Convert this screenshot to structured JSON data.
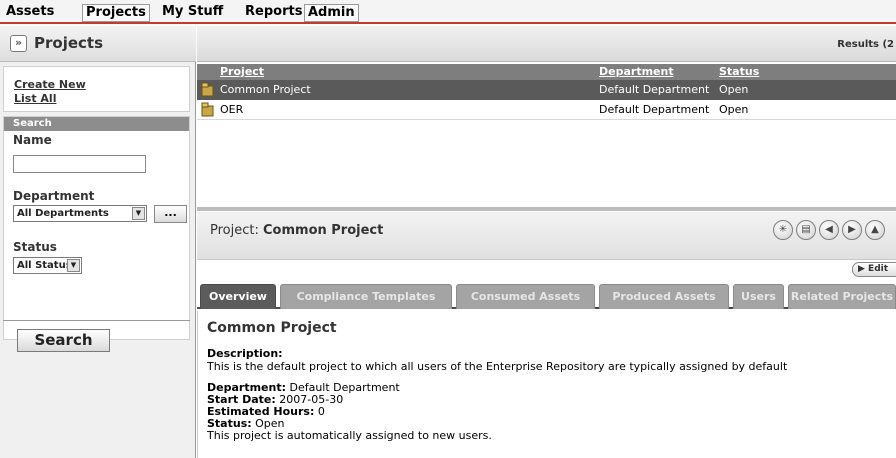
{
  "menu": {
    "items": [
      "Assets",
      "Projects",
      "My Stuff",
      "Reports",
      "Admin"
    ]
  },
  "sidebar": {
    "title": "Projects",
    "links": [
      "Create New",
      "List All"
    ],
    "search": {
      "header": "Search",
      "name_label": "Name",
      "name_value": "",
      "department_label": "Department",
      "department_value": "All Departments",
      "more_label": "...",
      "status_label": "Status",
      "status_value": "All Status",
      "button_label": "Search"
    }
  },
  "results": {
    "label": "Results (2",
    "columns": [
      "Project",
      "Department",
      "Status"
    ],
    "rows": [
      {
        "project": "Common Project",
        "department": "Default Department",
        "status": "Open",
        "selected": true
      },
      {
        "project": "OER",
        "department": "Default Department",
        "status": "Open",
        "selected": false
      }
    ]
  },
  "detail": {
    "label": "Project:",
    "name": "Common Project",
    "edit_label": "▶ Edit",
    "tabs": [
      "Overview",
      "Compliance Templates",
      "Consumed Assets",
      "Produced Assets",
      "Users",
      "Related Projects"
    ],
    "active_tab": "Overview",
    "content": {
      "title": "Common Project",
      "description_label": "Description:",
      "description": "This is the default project to which all users of the Enterprise Repository are typically assigned by default",
      "department_label": "Department:",
      "department": "Default Department",
      "start_date_label": "Start Date:",
      "start_date": "2007-05-30",
      "hours_label": "Estimated Hours:",
      "hours": "0",
      "status_label": "Status:",
      "status": "Open",
      "note": "This project is automatically assigned to new users."
    }
  },
  "colors": {
    "menu_underline": "#c63b2e",
    "selected_row": "#5a5a5a",
    "table_header": "#7e7e7e",
    "active_tab": "#5b5b5b",
    "inactive_tab": "#a4a4a4",
    "folder_icon": "#c9a646"
  },
  "icons": [
    "expand-icon",
    "folder-icon",
    "toolbar-star-icon",
    "toolbar-list-icon",
    "previous-icon",
    "next-icon",
    "navigate-icon"
  ]
}
